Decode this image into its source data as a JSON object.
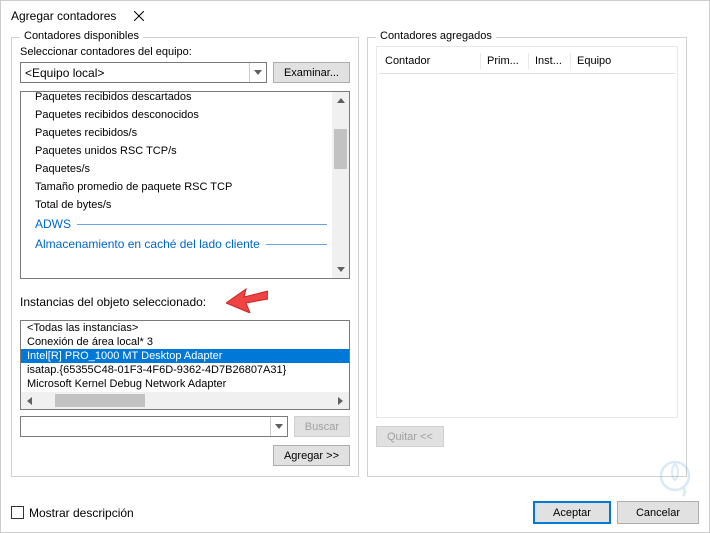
{
  "window": {
    "title": "Agregar contadores"
  },
  "left": {
    "legend": "Contadores disponibles",
    "selectLabel": "Seleccionar contadores del equipo:",
    "computer": "<Equipo local>",
    "browse": "Examinar...",
    "counters": [
      "Paquetes recibidos descartados",
      "Paquetes recibidos desconocidos",
      "Paquetes recibidos/s",
      "Paquetes unidos RSC TCP/s",
      "Paquetes/s",
      "Tamaño promedio de paquete RSC TCP",
      "Total de bytes/s"
    ],
    "categories": [
      "ADWS",
      "Almacenamiento en caché del lado cliente"
    ],
    "instancesLabel": "Instancias del objeto seleccionado:",
    "instances": [
      "<Todas las instancias>",
      "Conexión de área local* 3",
      "Intel[R] PRO_1000 MT Desktop Adapter",
      "isatap.{65355C48-01F3-4F6D-9362-4D7B26807A31}",
      "Microsoft Kernel Debug Network Adapter"
    ],
    "selectedInstanceIndex": 2,
    "search": "Buscar",
    "add": "Agregar >>"
  },
  "right": {
    "legend": "Contadores agregados",
    "headers": {
      "counter": "Contador",
      "parent": "Prim...",
      "inst": "Inst...",
      "computer": "Equipo"
    },
    "remove": "Quitar <<"
  },
  "footer": {
    "showDesc": "Mostrar descripción",
    "ok": "Aceptar",
    "cancel": "Cancelar"
  }
}
